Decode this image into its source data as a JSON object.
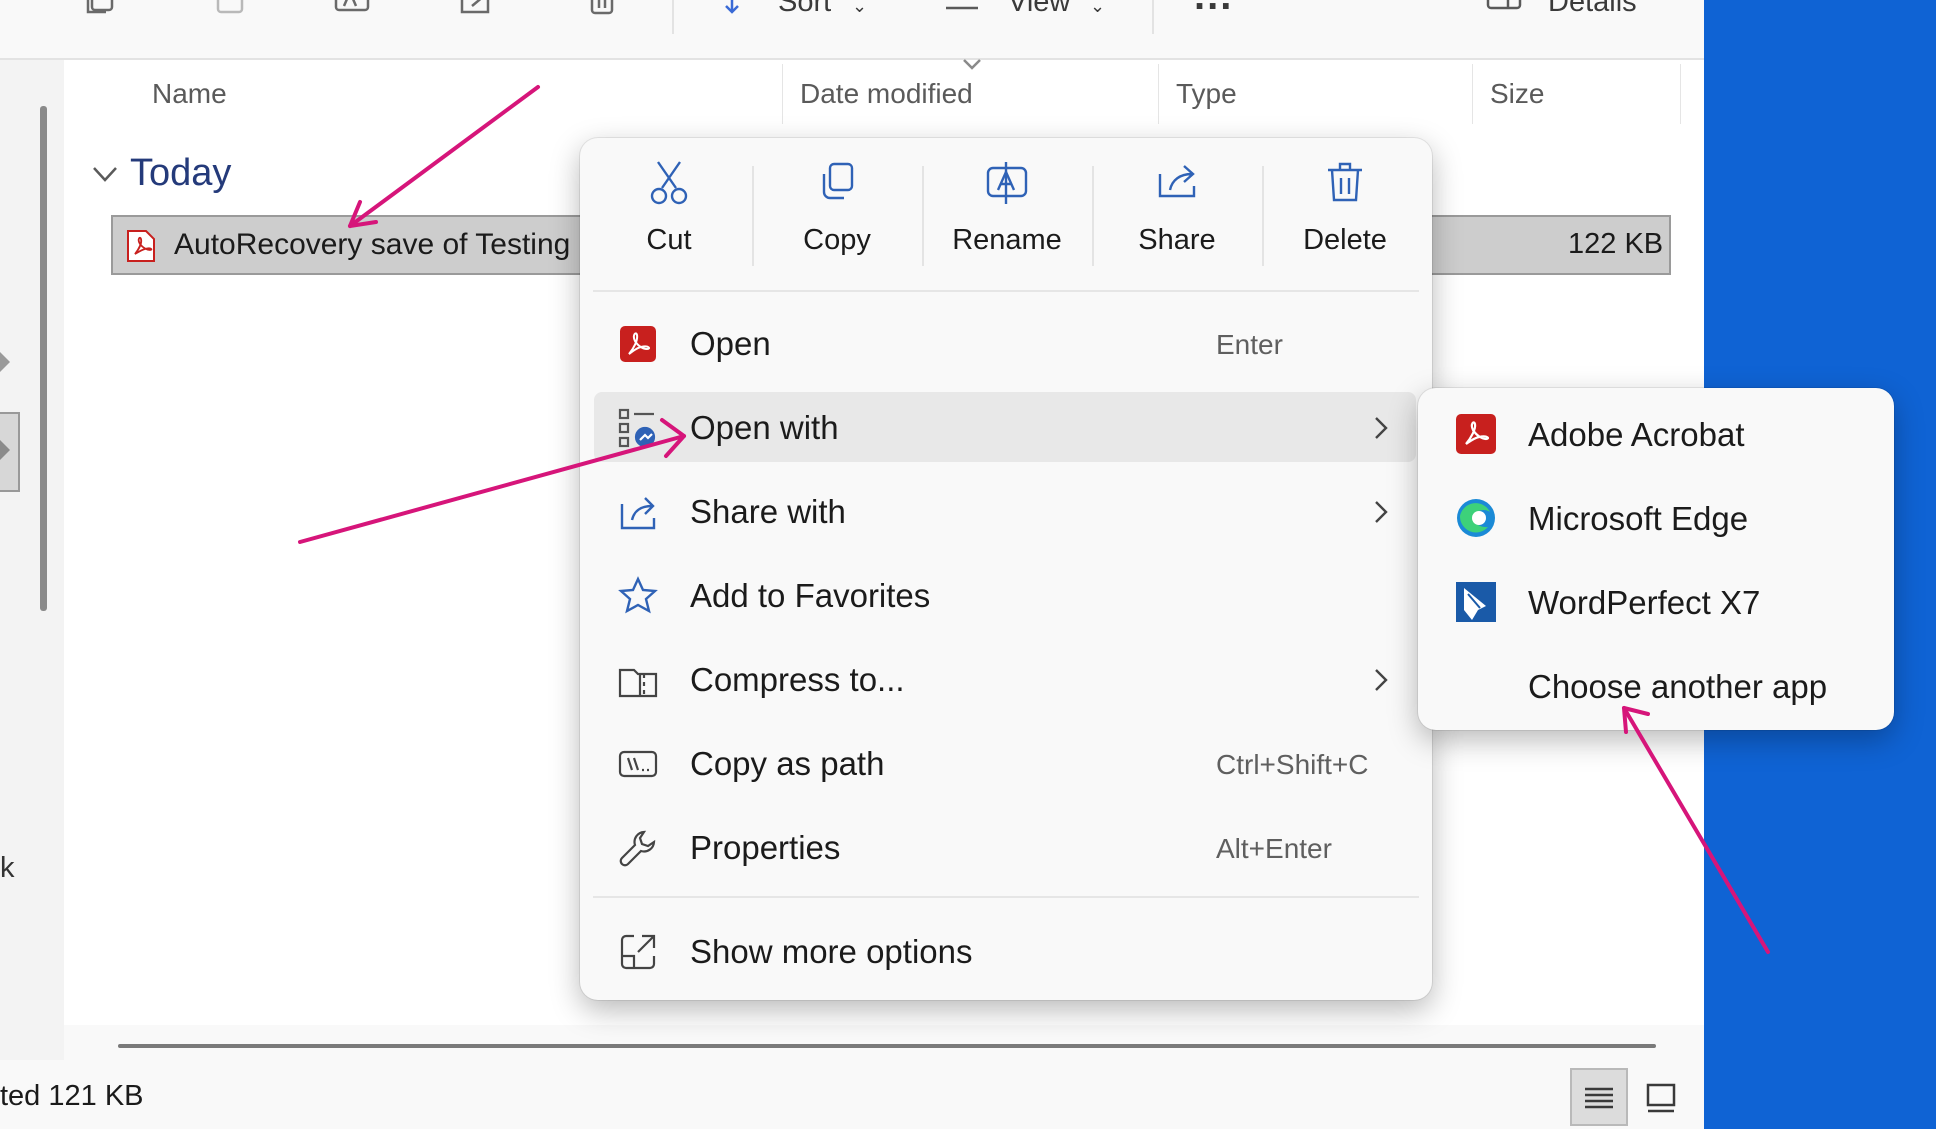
{
  "toolbar": {
    "sort_label": "Sort",
    "view_label": "View",
    "more_label": "...",
    "details_label": "Details"
  },
  "columns": {
    "name": "Name",
    "date_modified": "Date modified",
    "type": "Type",
    "size": "Size"
  },
  "group": {
    "label": "Today"
  },
  "file": {
    "name": "AutoRecovery save of Testing",
    "size": "122 KB"
  },
  "nav": {
    "partial_label": "k"
  },
  "status": {
    "text": "ted  121 KB"
  },
  "context_menu": {
    "quick_actions": [
      {
        "label": "Cut",
        "icon": "scissors-icon"
      },
      {
        "label": "Copy",
        "icon": "copy-icon"
      },
      {
        "label": "Rename",
        "icon": "rename-icon"
      },
      {
        "label": "Share",
        "icon": "share-icon"
      },
      {
        "label": "Delete",
        "icon": "trash-icon"
      }
    ],
    "items": [
      {
        "label": "Open",
        "shortcut": "Enter",
        "icon": "pdf-icon"
      },
      {
        "label": "Open with",
        "icon": "open-with-icon",
        "submenu": true
      },
      {
        "label": "Share with",
        "icon": "share-with-icon",
        "submenu": true
      },
      {
        "label": "Add to Favorites",
        "icon": "star-icon"
      },
      {
        "label": "Compress to...",
        "icon": "zip-folder-icon",
        "submenu": true
      },
      {
        "label": "Copy as path",
        "shortcut": "Ctrl+Shift+C",
        "icon": "path-icon"
      },
      {
        "label": "Properties",
        "shortcut": "Alt+Enter",
        "icon": "wrench-icon"
      },
      {
        "label": "Show more options",
        "icon": "expand-icon"
      }
    ]
  },
  "open_with_submenu": {
    "items": [
      {
        "label": "Adobe Acrobat",
        "icon": "acrobat-icon"
      },
      {
        "label": "Microsoft Edge",
        "icon": "edge-icon"
      },
      {
        "label": "WordPerfect X7",
        "icon": "wordperfect-icon"
      },
      {
        "label": "Choose another app",
        "icon": ""
      }
    ]
  },
  "colors": {
    "accent_pdf": "#c8201e",
    "annotation": "#d6157a",
    "desktop_blue": "#0f63d4",
    "group_label": "#243a7a"
  }
}
